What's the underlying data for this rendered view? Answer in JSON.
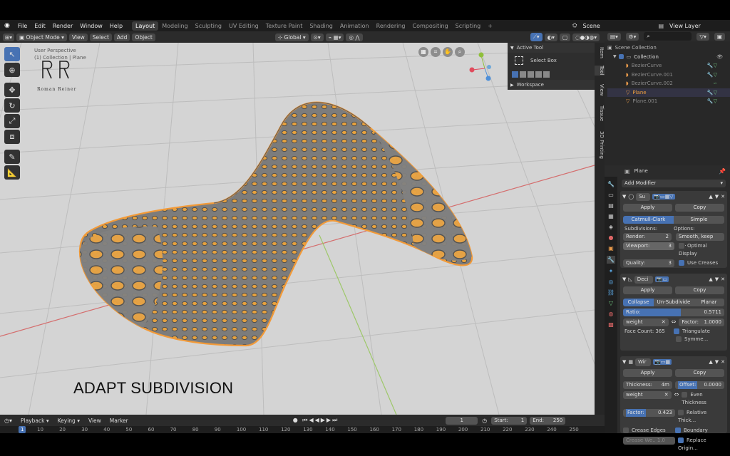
{
  "menu": {
    "items": [
      "File",
      "Edit",
      "Render",
      "Window",
      "Help"
    ],
    "workspaces": [
      "Layout",
      "Modeling",
      "Sculpting",
      "UV Editing",
      "Texture Paint",
      "Shading",
      "Animation",
      "Rendering",
      "Compositing",
      "Scripting"
    ],
    "active_workspace": "Layout",
    "add_workspace": "+",
    "scene_label": "Scene",
    "view_layer_label": "View Layer"
  },
  "header": {
    "mode": "Object Mode",
    "view": "View",
    "select": "Select",
    "add": "Add",
    "object": "Object",
    "orientation": "Global"
  },
  "viewport": {
    "perspective": "User Perspective",
    "collection": "(1) Collection | Plane",
    "logo_text": "Roman Reiner",
    "caption": "ADAPT SUBDIVISION",
    "mesh_color": "#8a8a8a",
    "outline_color": "#f29a38",
    "background": "#d4d4d4"
  },
  "npanel": {
    "active_tool_title": "Active Tool",
    "tool_name": "Select Box",
    "workspace_title": "Workspace",
    "tabs": [
      "Item",
      "Tool",
      "View",
      "Tissue",
      "3D Printing"
    ]
  },
  "outliner": {
    "root": "Scene Collection",
    "collection": "Collection",
    "items": [
      "BezierCurve",
      "BezierCurve.001",
      "BezierCurve.002",
      "Plane",
      "Plane.001"
    ],
    "selected": "Plane"
  },
  "properties": {
    "object_name": "Plane",
    "add_modifier": "Add Modifier",
    "subsurf": {
      "name": "Su",
      "apply": "Apply",
      "copy": "Copy",
      "type_a": "Catmull-Clark",
      "type_b": "Simple",
      "subdivisions_label": "Subdivisions:",
      "options_label": "Options:",
      "render_label": "Render:",
      "render_value": "2",
      "viewport_label": "Viewport:",
      "viewport_value": "3",
      "quality_label": "Quality:",
      "quality_value": "3",
      "smooth": "Smooth, keep c...",
      "optimal_display": "Optimal Display",
      "use_creases": "Use Creases"
    },
    "decimate": {
      "name": "Deci",
      "apply": "Apply",
      "copy": "Copy",
      "collapse": "Collapse",
      "unsubdivide": "Un-Subdivide",
      "planar": "Planar",
      "ratio_label": "Ratio:",
      "ratio_value": "0.5711",
      "ratio_fraction": 0.5711,
      "weight": "weight",
      "factor_label": "Factor:",
      "factor_value": "1.0000",
      "face_count": "Face Count: 365",
      "triangulate": "Triangulate",
      "symmetry": "Symme..."
    },
    "wireframe": {
      "name": "Wir",
      "apply": "Apply",
      "copy": "Copy",
      "thickness_label": "Thickness:",
      "thickness_value": "4m",
      "offset_label": "Offset:",
      "offset_value": "0.0000",
      "weight": "weight",
      "even_thickness": "Even Thickness",
      "factor_label": "Factor:",
      "factor_value": "0.423",
      "relative_thick": "Relative Thick...",
      "crease_edges": "Crease Edges",
      "boundary": "Boundary",
      "crease_weight": "Crease We.. 1.0",
      "replace_original": "Replace Origin..."
    }
  },
  "timeline": {
    "playback": "Playback",
    "keying": "Keying",
    "view": "View",
    "marker": "Marker",
    "current_frame": "1",
    "start_label": "Start:",
    "start_value": "1",
    "end_label": "End:",
    "end_value": "250",
    "ticks": [
      "1",
      "10",
      "20",
      "30",
      "40",
      "50",
      "60",
      "70",
      "80",
      "90",
      "100",
      "110",
      "120",
      "130",
      "140",
      "150",
      "160",
      "170",
      "180",
      "190",
      "200",
      "210",
      "220",
      "230",
      "240",
      "250"
    ]
  }
}
